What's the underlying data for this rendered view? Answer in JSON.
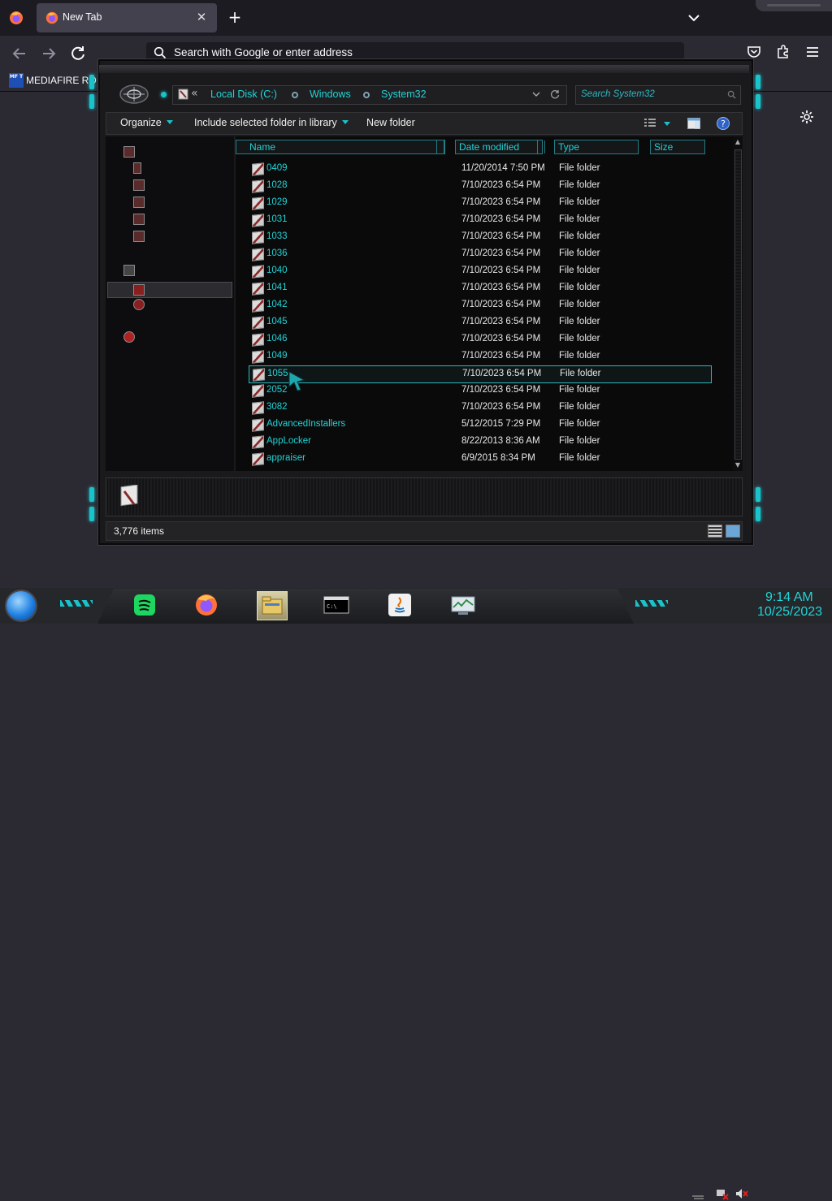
{
  "browser": {
    "tab": {
      "title": "New Tab",
      "close": "✕"
    },
    "new_tab": "+",
    "urlbar": {
      "placeholder": "Search with Google or enter address"
    },
    "bookmark": {
      "icon_text": "MF T",
      "label": "MEDIAFIRE RO"
    }
  },
  "explorer": {
    "breadcrumb": {
      "overflow": "«",
      "items": [
        "Local Disk (C:)",
        "Windows",
        "System32"
      ]
    },
    "search": {
      "placeholder": "Search System32"
    },
    "toolbar": {
      "organize": "Organize",
      "include": "Include selected folder in library",
      "new_folder": "New folder"
    },
    "columns": [
      "Name",
      "Date modified",
      "Type",
      "Size"
    ],
    "files": [
      {
        "name": "0409",
        "date": "11/20/2014 7:50 PM",
        "type": "File folder"
      },
      {
        "name": "1028",
        "date": "7/10/2023 6:54 PM",
        "type": "File folder"
      },
      {
        "name": "1029",
        "date": "7/10/2023 6:54 PM",
        "type": "File folder"
      },
      {
        "name": "1031",
        "date": "7/10/2023 6:54 PM",
        "type": "File folder"
      },
      {
        "name": "1033",
        "date": "7/10/2023 6:54 PM",
        "type": "File folder"
      },
      {
        "name": "1036",
        "date": "7/10/2023 6:54 PM",
        "type": "File folder"
      },
      {
        "name": "1040",
        "date": "7/10/2023 6:54 PM",
        "type": "File folder"
      },
      {
        "name": "1041",
        "date": "7/10/2023 6:54 PM",
        "type": "File folder"
      },
      {
        "name": "1042",
        "date": "7/10/2023 6:54 PM",
        "type": "File folder"
      },
      {
        "name": "1045",
        "date": "7/10/2023 6:54 PM",
        "type": "File folder"
      },
      {
        "name": "1046",
        "date": "7/10/2023 6:54 PM",
        "type": "File folder"
      },
      {
        "name": "1049",
        "date": "7/10/2023 6:54 PM",
        "type": "File folder"
      },
      {
        "name": "1055",
        "date": "7/10/2023 6:54 PM",
        "type": "File folder",
        "selected": true
      },
      {
        "name": "2052",
        "date": "7/10/2023 6:54 PM",
        "type": "File folder"
      },
      {
        "name": "3082",
        "date": "7/10/2023 6:54 PM",
        "type": "File folder"
      },
      {
        "name": "AdvancedInstallers",
        "date": "5/12/2015 7:29 PM",
        "type": "File folder"
      },
      {
        "name": "AppLocker",
        "date": "8/22/2013 8:36 AM",
        "type": "File folder"
      },
      {
        "name": "appraiser",
        "date": "6/9/2015 8:34 PM",
        "type": "File folder"
      }
    ],
    "status": {
      "item_count": "3,776 items"
    }
  },
  "taskbar": {
    "apps": [
      "spotify-icon",
      "firefox-icon",
      "file-explorer-icon",
      "command-prompt-icon",
      "java-icon",
      "resource-monitor-icon"
    ],
    "clock": {
      "time": "9:14 AM",
      "date": "10/25/2023"
    }
  },
  "colors": {
    "accent": "#21d4d6",
    "frame": "#1a1a1c",
    "browser_bg": "#2b2a33"
  }
}
